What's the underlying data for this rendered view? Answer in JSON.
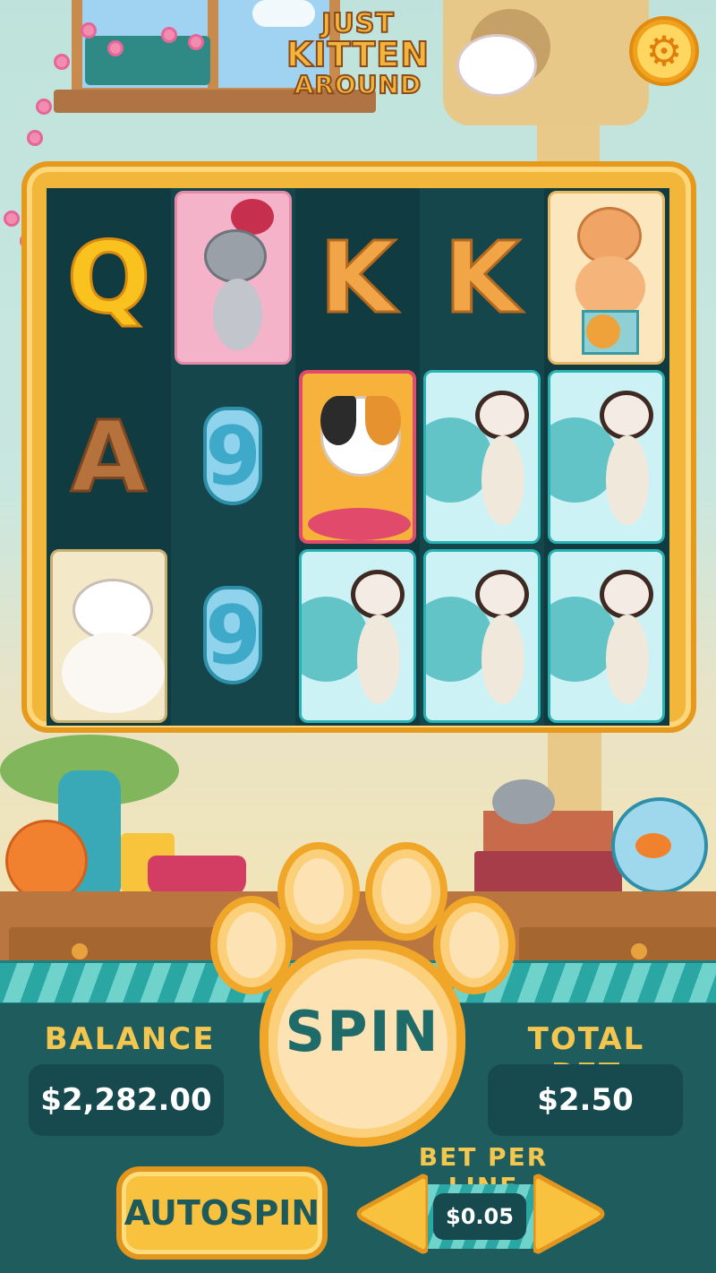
{
  "game": {
    "title_line1": "JUST",
    "title_line2": "KITTEN",
    "title_line3": "AROUND"
  },
  "icons": {
    "settings": "gear-icon",
    "prev": "arrow-left-icon",
    "next": "arrow-right-icon"
  },
  "reels": [
    [
      "Q",
      "A",
      "ragdoll-cat"
    ],
    [
      "grey-cat-yarn",
      "9",
      "9"
    ],
    [
      "K",
      "calico-cat",
      "siamese-cat"
    ],
    [
      "K",
      "siamese-cat",
      "siamese-cat"
    ],
    [
      "persian-cat",
      "siamese-cat",
      "siamese-cat"
    ]
  ],
  "balance": {
    "label": "BALANCE",
    "value": "$2,282.00"
  },
  "total_bet": {
    "label": "TOTAL BET",
    "value": "$2.50"
  },
  "spin": {
    "label": "SPIN"
  },
  "autospin": {
    "label": "AUTOSPIN"
  },
  "bet_per_line": {
    "label": "BET PER LINE",
    "value": "$0.05"
  },
  "colors": {
    "accent_gold": "#f3c64f",
    "panel_teal": "#1f5c5e",
    "reel_bg": "#0f3b41"
  }
}
